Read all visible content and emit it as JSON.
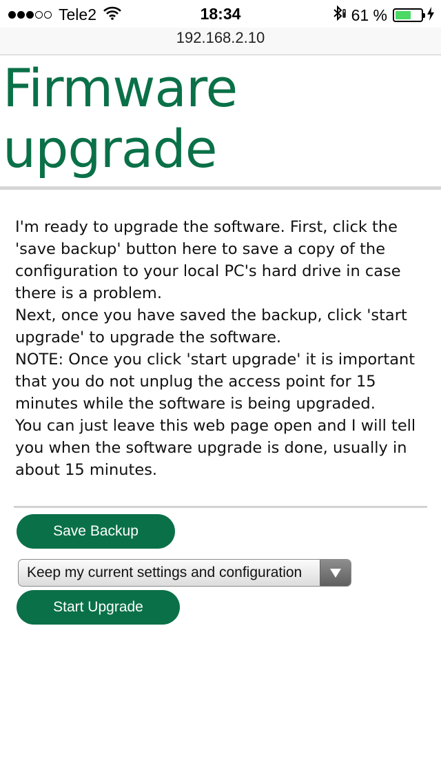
{
  "status_bar": {
    "signal_bars_filled": 3,
    "signal_bars_total": 5,
    "carrier": "Tele2",
    "time": "18:34",
    "battery_percent": "61 %",
    "battery_level": 0.61,
    "battery_color": "#4cd964"
  },
  "browser": {
    "url": "192.168.2.10"
  },
  "page": {
    "title": "Firmware upgrade",
    "accent_color": "#0a7048",
    "paragraphs": [
      "I'm ready to upgrade the software. First, click the 'save backup' button here to save a copy of the configuration to your local PC's hard drive in case there is a problem.",
      "Next, once you have saved the backup, click 'start upgrade' to upgrade the software.",
      "NOTE: Once you click 'start upgrade' it is important that you do not unplug the access point for 15 minutes while the software is being upgraded.",
      "You can just leave this web page open and I will tell you when the software upgrade is done, usually in about 15 minutes."
    ],
    "save_backup_label": "Save Backup",
    "settings_select_value": "Keep my current settings and configuration",
    "start_upgrade_label": "Start Upgrade"
  },
  "icons": [
    "signal-dots-icon",
    "wifi-icon",
    "bluetooth-icon",
    "battery-icon",
    "charging-bolt-icon",
    "dropdown-arrow-icon"
  ]
}
